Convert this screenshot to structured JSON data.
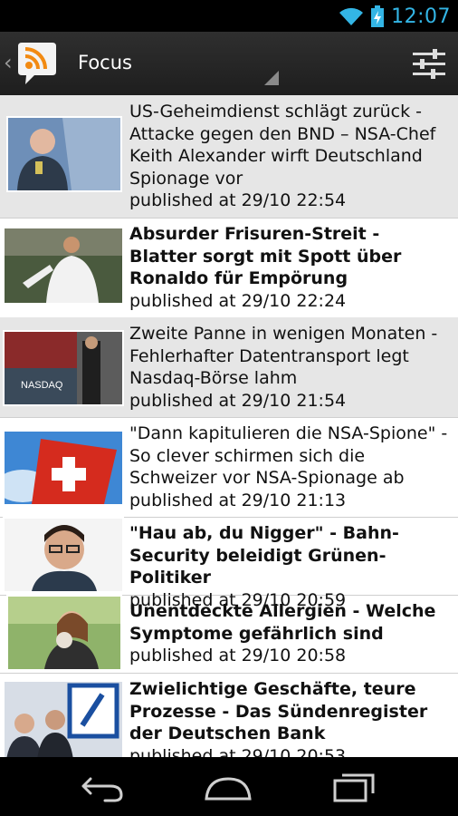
{
  "status_bar": {
    "time": "12:07"
  },
  "action_bar": {
    "title": "Focus"
  },
  "articles": [
    {
      "headline": "US-Geheimdienst schlägt zurück - Attacke gegen den BND – NSA-Chef Keith Alexander wirft Deutschland Spionage vor",
      "published": "published at 29/10 22:54",
      "bold": false
    },
    {
      "headline": "Absurder Frisuren-Streit - Blatter sorgt mit Spott über Ronaldo für Empörung",
      "published": "published at 29/10 22:24",
      "bold": true
    },
    {
      "headline": "Zweite Panne in wenigen Monaten - Fehlerhafter Datentransport legt Nasdaq-Börse lahm",
      "published": "published at 29/10 21:54",
      "bold": false
    },
    {
      "headline": "\"Dann kapitulieren die NSA-Spione\" - So clever schirmen sich die Schweizer vor NSA-Spionage ab",
      "published": "published at 29/10 21:13",
      "bold": false
    },
    {
      "headline": "\"Hau ab, du Nigger\" - Bahn-Security beleidigt Grünen-Politiker",
      "published": "published at 29/10 20:59",
      "bold": true
    },
    {
      "headline": "Unentdeckte Allergien - Welche Symptome gefährlich sind",
      "published": "published at 29/10 20:58",
      "bold": true
    },
    {
      "headline": "Zwielichtige Geschäfte, teure Prozesse - Das Sündenregister der Deutschen Bank",
      "published": "published at 29/10 20:53",
      "bold": true
    }
  ],
  "thumb_texts": {
    "nasdaq": "NASDAQ"
  },
  "colors": {
    "accent": "#33b5e5",
    "shaded_row": "#e6e6e6",
    "action_bar": "#2a2a2a"
  }
}
